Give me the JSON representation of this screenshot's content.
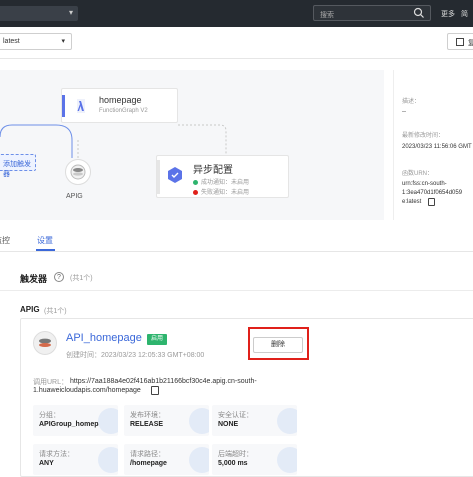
{
  "topbar": {
    "search_placeholder": "搜索",
    "link_1": "更多",
    "link_2": "简"
  },
  "subbar": {
    "version_value": "latest",
    "right_button_label": "复"
  },
  "canvas": {
    "function_card": {
      "name": "homepage",
      "runtime": "FunctionGraph V2"
    },
    "trigger_add_label": "添加触发器",
    "apig_label": "APIG",
    "async_card": {
      "title": "异步配置",
      "success_text": "成功通知：未启用",
      "failure_text": "失败通知：未启用",
      "success_color": "#2db46d",
      "failure_color": "#e0201a"
    }
  },
  "right_panel": {
    "desc_label": "描述：",
    "desc_value": "--",
    "modified_label": "最新修改时间：",
    "modified_value": "2023/03/23 11:56:06 GMT",
    "urn_label": "函数URN：",
    "urn_value_1": "urn:fss:cn-south-",
    "urn_value_2": "1:3ea470d1f0654d059",
    "urn_value_3": "e:latest"
  },
  "tabs": [
    {
      "label": "监控"
    },
    {
      "label": "设置"
    }
  ],
  "triggers": {
    "title": "触发器",
    "count": "(共1个)",
    "group_title": "APIG",
    "group_count": "(共1个)",
    "card": {
      "api_name": "API_homepage",
      "status_badge": "启用",
      "created_time": "创建时间：2023/03/23 12:05:33 GMT+08:00",
      "delete_label": "删除",
      "url_label": "调用URL：",
      "url_line1": "https://7aa188a4e02f416ab1b21166bcf30c4e.apig.cn-south-",
      "url_line2": "1.huaweicloudapis.com/homepage",
      "info": [
        {
          "label": "分组：",
          "value": "APIGroup_homepage"
        },
        {
          "label": "发布环境：",
          "value": "RELEASE"
        },
        {
          "label": "安全认证：",
          "value": "NONE"
        },
        {
          "label": "请求方法：",
          "value": "ANY"
        },
        {
          "label": "请求路径：",
          "value": "/homepage"
        },
        {
          "label": "后端超时：",
          "value": "5,000 ms"
        }
      ]
    }
  },
  "colors": {
    "accent": "#3b68d9",
    "highlight_box": "#e0201a",
    "status_green": "#2db46d"
  }
}
